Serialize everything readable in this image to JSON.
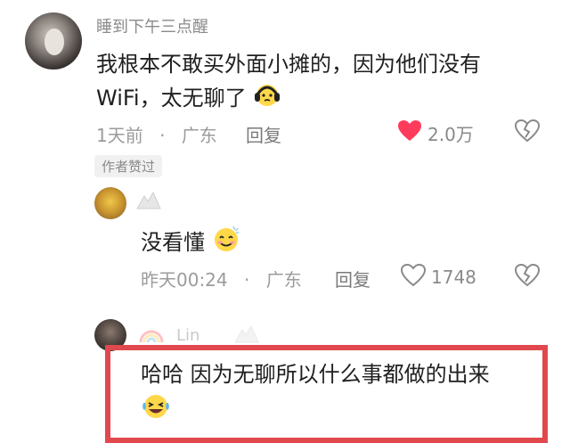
{
  "thread": {
    "main": {
      "username": "睡到下午三点醒",
      "text": "我根本不敢买外面小摊的，因为他们没有",
      "text_line2": "WiFi，太无聊了",
      "time": "1天前",
      "separator": "·",
      "location": "广东",
      "reply_label": "回复",
      "likes": "2.0万",
      "badge": "作者赞过"
    },
    "reply1": {
      "text": "没看懂",
      "time": "昨天00:24",
      "separator": "·",
      "location": "广东",
      "reply_label": "回复",
      "likes": "1748"
    },
    "reply2": {
      "username": "Lin",
      "text": "哈哈  因为无聊所以什么事都做的出来"
    }
  },
  "colors": {
    "like_active": "#ff3b5c",
    "text_primary": "#1f1f1f",
    "text_secondary": "#9b9b9b",
    "highlight_border": "#e0484e"
  },
  "icons": {
    "main_emoji": "headphones-emoji-icon",
    "reply1_emoji": "blushing-smile-emoji-icon",
    "reply2_emoji": "laughing-tears-emoji-icon",
    "like_filled": "heart-filled-icon",
    "like_outline": "heart-outline-icon",
    "dislike": "broken-heart-icon"
  }
}
